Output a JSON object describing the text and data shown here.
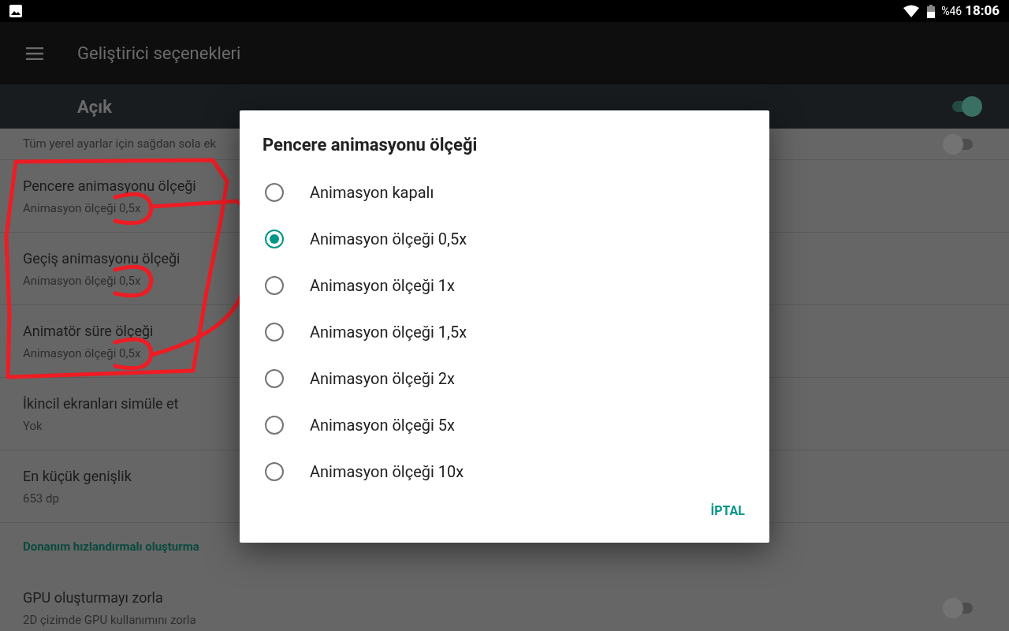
{
  "status_bar": {
    "battery": "%46",
    "time": "18:06"
  },
  "toolbar": {
    "title": "Geliştirici seçenekleri"
  },
  "master": {
    "label": "Açık",
    "on": true
  },
  "rows": [
    {
      "kind": "switch",
      "summary": "Tüm yerel ayarlar için sağdan sola ek",
      "on": false
    },
    {
      "kind": "item",
      "title": "Pencere animasyonu ölçeği",
      "summary": "Animasyon ölçeği 0,5x"
    },
    {
      "kind": "item",
      "title": "Geçiş animasyonu ölçeği",
      "summary": "Animasyon ölçeği 0,5x"
    },
    {
      "kind": "item",
      "title": "Animatör süre ölçeği",
      "summary": "Animasyon ölçeği 0,5x"
    },
    {
      "kind": "item",
      "title": "İkincil ekranları simüle et",
      "summary": "Yok"
    },
    {
      "kind": "item",
      "title": "En küçük genişlik",
      "summary": "653 dp"
    },
    {
      "kind": "header",
      "title": "Donanım hızlandırmalı oluşturma"
    },
    {
      "kind": "switch",
      "title": "GPU oluşturmayı zorla",
      "summary": "2D çizimde GPU kullanımını zorla",
      "on": false
    }
  ],
  "dialog": {
    "title": "Pencere animasyonu ölçeği",
    "options": [
      {
        "label": "Animasyon kapalı",
        "selected": false
      },
      {
        "label": "Animasyon ölçeği 0,5x",
        "selected": true
      },
      {
        "label": "Animasyon ölçeği 1x",
        "selected": false
      },
      {
        "label": "Animasyon ölçeği 1,5x",
        "selected": false
      },
      {
        "label": "Animasyon ölçeği 2x",
        "selected": false
      },
      {
        "label": "Animasyon ölçeği 5x",
        "selected": false
      },
      {
        "label": "Animasyon ölçeği 10x",
        "selected": false
      }
    ],
    "cancel": "İPTAL"
  }
}
